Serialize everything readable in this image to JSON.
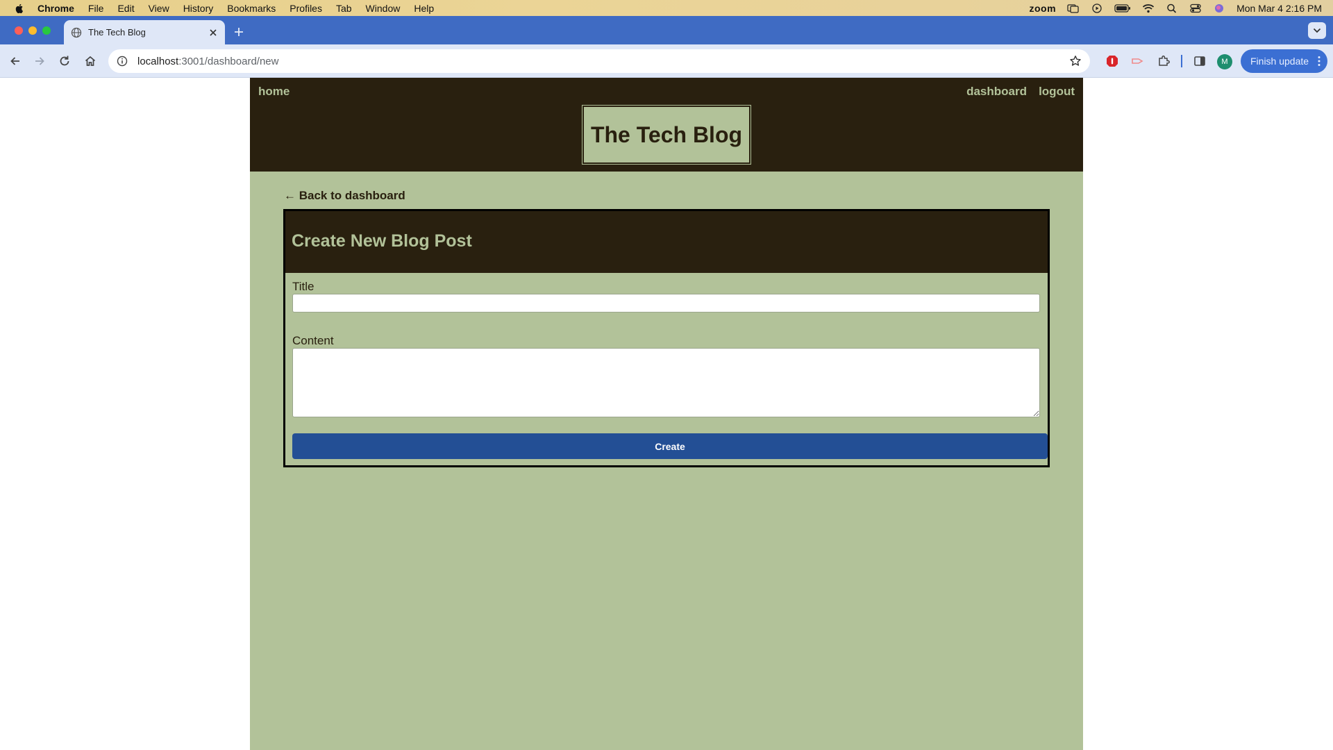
{
  "menubar": {
    "app": "Chrome",
    "items": [
      "File",
      "Edit",
      "View",
      "History",
      "Bookmarks",
      "Profiles",
      "Tab",
      "Window",
      "Help"
    ],
    "zoom_label": "zoom",
    "clock": "Mon Mar 4  2:16 PM"
  },
  "browser": {
    "tab_title": "The Tech Blog",
    "url_host": "localhost",
    "url_path": ":3001/dashboard/new",
    "avatar_letter": "M",
    "finish_update": "Finish update"
  },
  "site": {
    "nav": {
      "home": "home",
      "dashboard": "dashboard",
      "logout": "logout"
    },
    "brand": "The Tech Blog",
    "back_link": "← Back to dashboard",
    "form": {
      "heading": "Create New Blog Post",
      "title_label": "Title",
      "title_value": "",
      "content_label": "Content",
      "content_value": "",
      "submit": "Create"
    }
  },
  "colors": {
    "header_bg": "#29200f",
    "page_bg": "#b2c299",
    "button": "#234f95",
    "chrome_tabstrip": "#3f6bc3"
  }
}
